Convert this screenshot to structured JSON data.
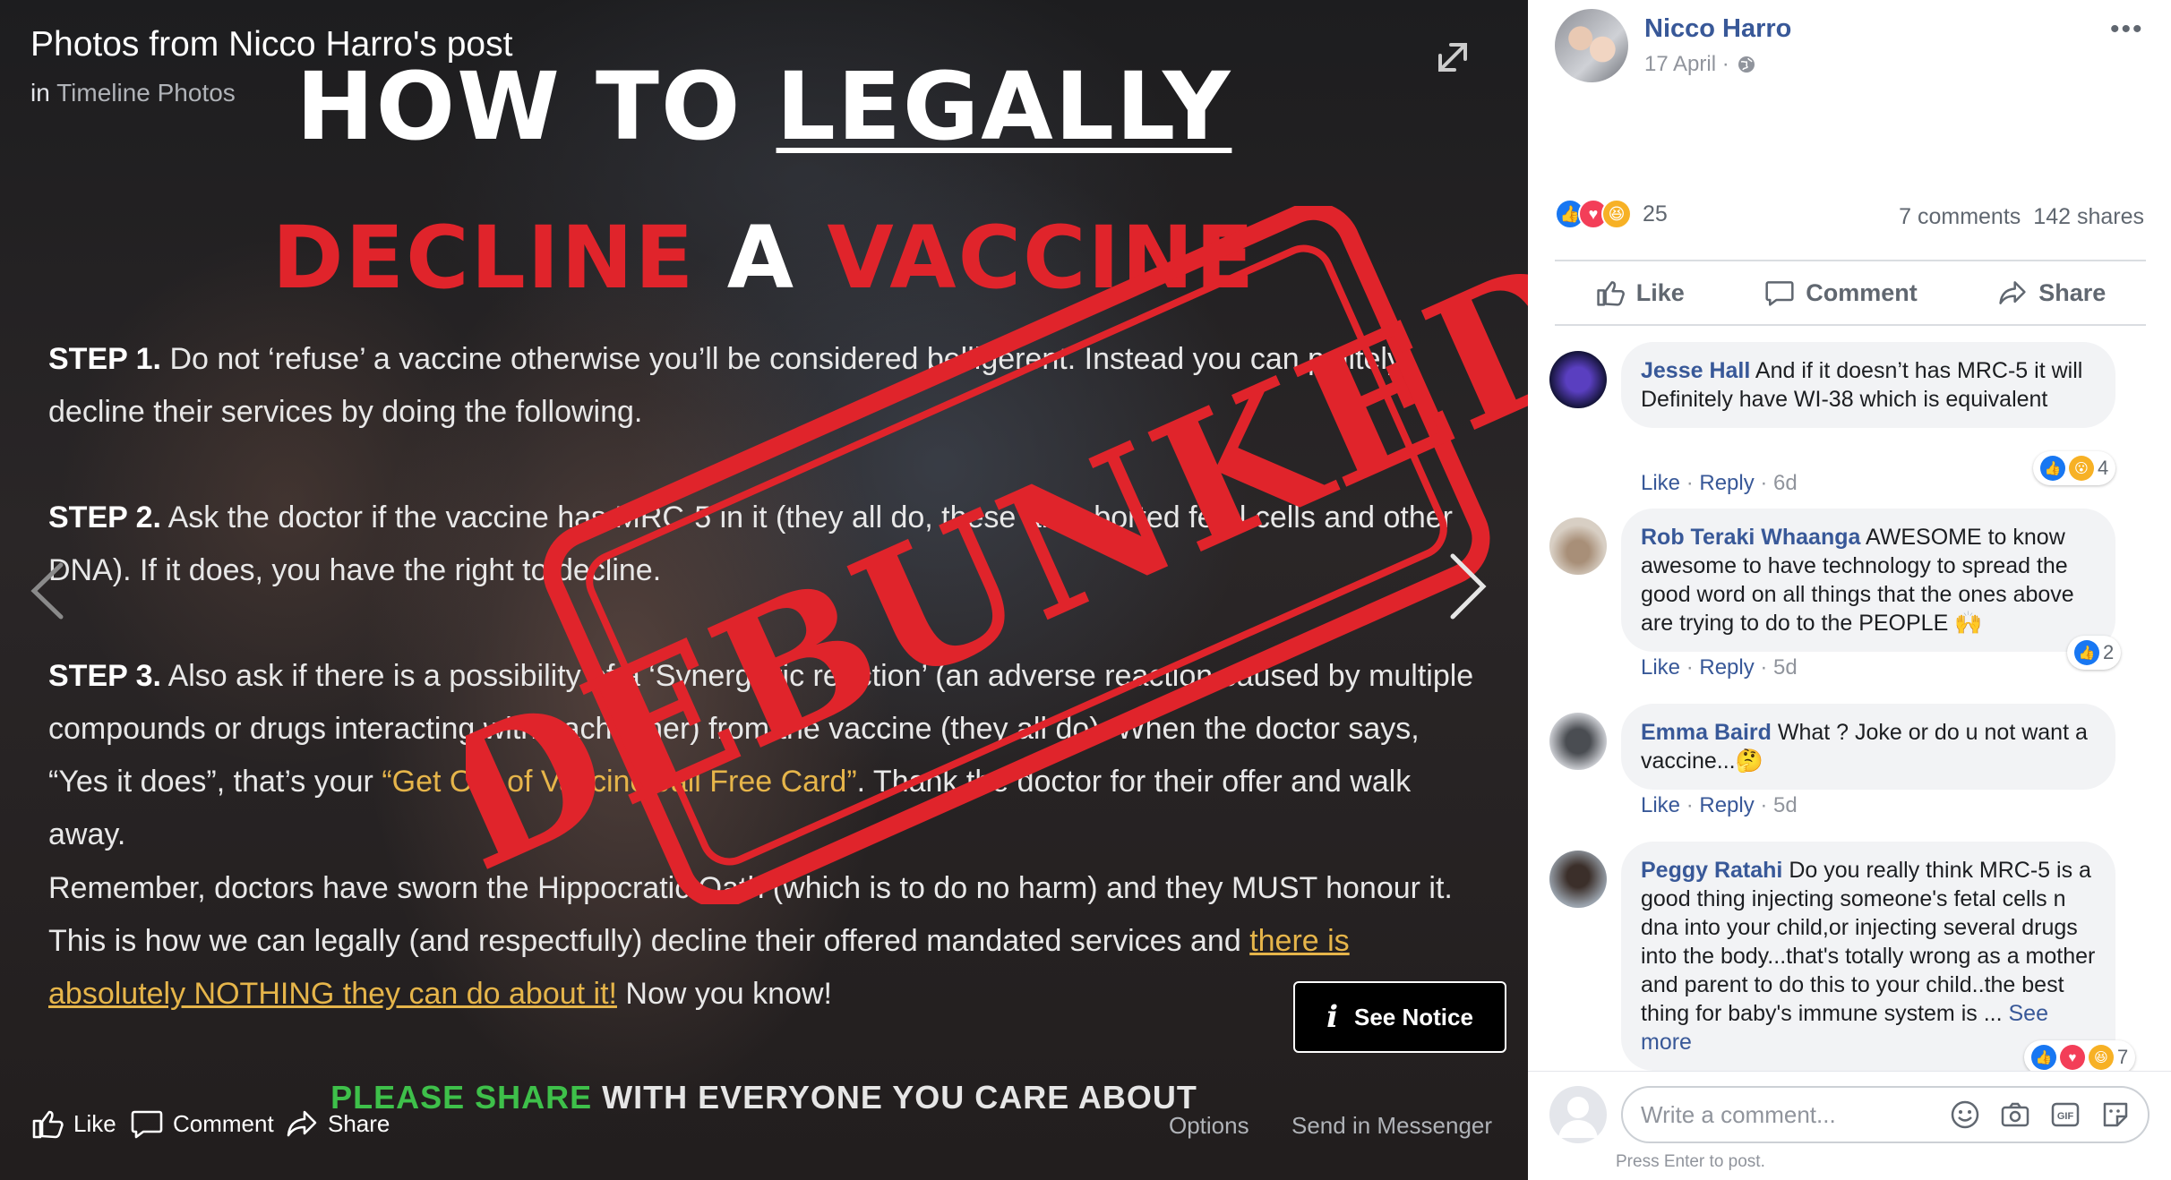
{
  "viewer": {
    "title": "Photos from Nicco Harro's post",
    "subtitle_prefix": "in",
    "subtitle_album": "Timeline Photos",
    "see_notice_label": "See Notice",
    "actions": {
      "like": "Like",
      "comment": "Comment",
      "share": "Share"
    },
    "options_label": "Options",
    "messenger_label": "Send in Messenger"
  },
  "photo": {
    "heading_part1": "HOW TO ",
    "heading_part2": "LEGALLY",
    "heading2_part1": "DECLINE",
    "heading2_part2": " A ",
    "heading2_part3": "VACCINE",
    "step1_label": "STEP 1.",
    "step1_text": " Do not ‘refuse’ a vaccine otherwise you’ll be considered belligerent. Instead you can politely decline their services by doing the following.",
    "step2_label": "STEP 2.",
    "step2_text": " Ask the doctor if the vaccine has MRC-5 in it (they all do, these are aborted fetal cells and other DNA). If it does, you have the right to decline.",
    "step3_label": "STEP 3.",
    "step3_text_a": " Also ask if there is a possibility of a ‘Synergistic reaction’ (an adverse reaction caused by multiple compounds or drugs interacting with each other) from the vaccine (they all do). When the doctor says, “Yes it does”, that’s your ",
    "step3_gold": "“Get Out of Vaccine Jail Free Card”",
    "step3_text_b": ". Thank the doctor for their offer and walk away.",
    "remember_text_a": "Remember, doctors have sworn the Hippocratic Oath (which is to do no harm) and they MUST honour it. This is how we can legally (and respectfully) decline their offered mandated services and ",
    "remember_gold": "there is absolutely NOTHING they can do about it!",
    "remember_text_b": " Now you know!",
    "banner_green": "PLEASE SHARE",
    "banner_white": " WITH EVERYONE YOU CARE ABOUT",
    "stamp_text": "DEBUNKED"
  },
  "post": {
    "author": "Nicco Harro",
    "date": "17 April ·",
    "reaction_count": "25",
    "comments_count": "7 comments",
    "shares_count": "142 shares",
    "actions": {
      "like": "Like",
      "comment": "Comment",
      "share": "Share"
    }
  },
  "comments": [
    {
      "name": "Jesse Hall",
      "text": "And if it doesn’t has MRC-5 it will Definitely have WI-38 which is equivalent",
      "like": "Like",
      "reply": "Reply",
      "age": "6d",
      "reactions": "4"
    },
    {
      "name": "Rob Teraki Whaanga",
      "text": "AWESOME to know awesome to have technology to spread the good word on all things that the ones above are trying to do to the PEOPLE 🙌",
      "like": "Like",
      "reply": "Reply",
      "age": "5d",
      "reactions": "2"
    },
    {
      "name": "Emma Baird",
      "text": "What ? Joke or do u not want a vaccine...🤔",
      "like": "Like",
      "reply": "Reply",
      "age": "5d"
    },
    {
      "name": "Peggy Ratahi",
      "text": "Do you really think MRC-5 is a good thing injecting someone's fetal cells n dna into your child,or injecting several drugs into the body...that's totally wrong as a mother and parent to do this to your child..the best thing for baby's immune system is ...",
      "see_more": "See more",
      "reactions": "7"
    }
  ],
  "composer": {
    "placeholder": "Write a comment...",
    "hint": "Press Enter to post."
  },
  "colors": {
    "fb_blue": "#385898",
    "stamp_red": "#e0242b",
    "gold": "#e6b54a",
    "green": "#3ec04a"
  }
}
